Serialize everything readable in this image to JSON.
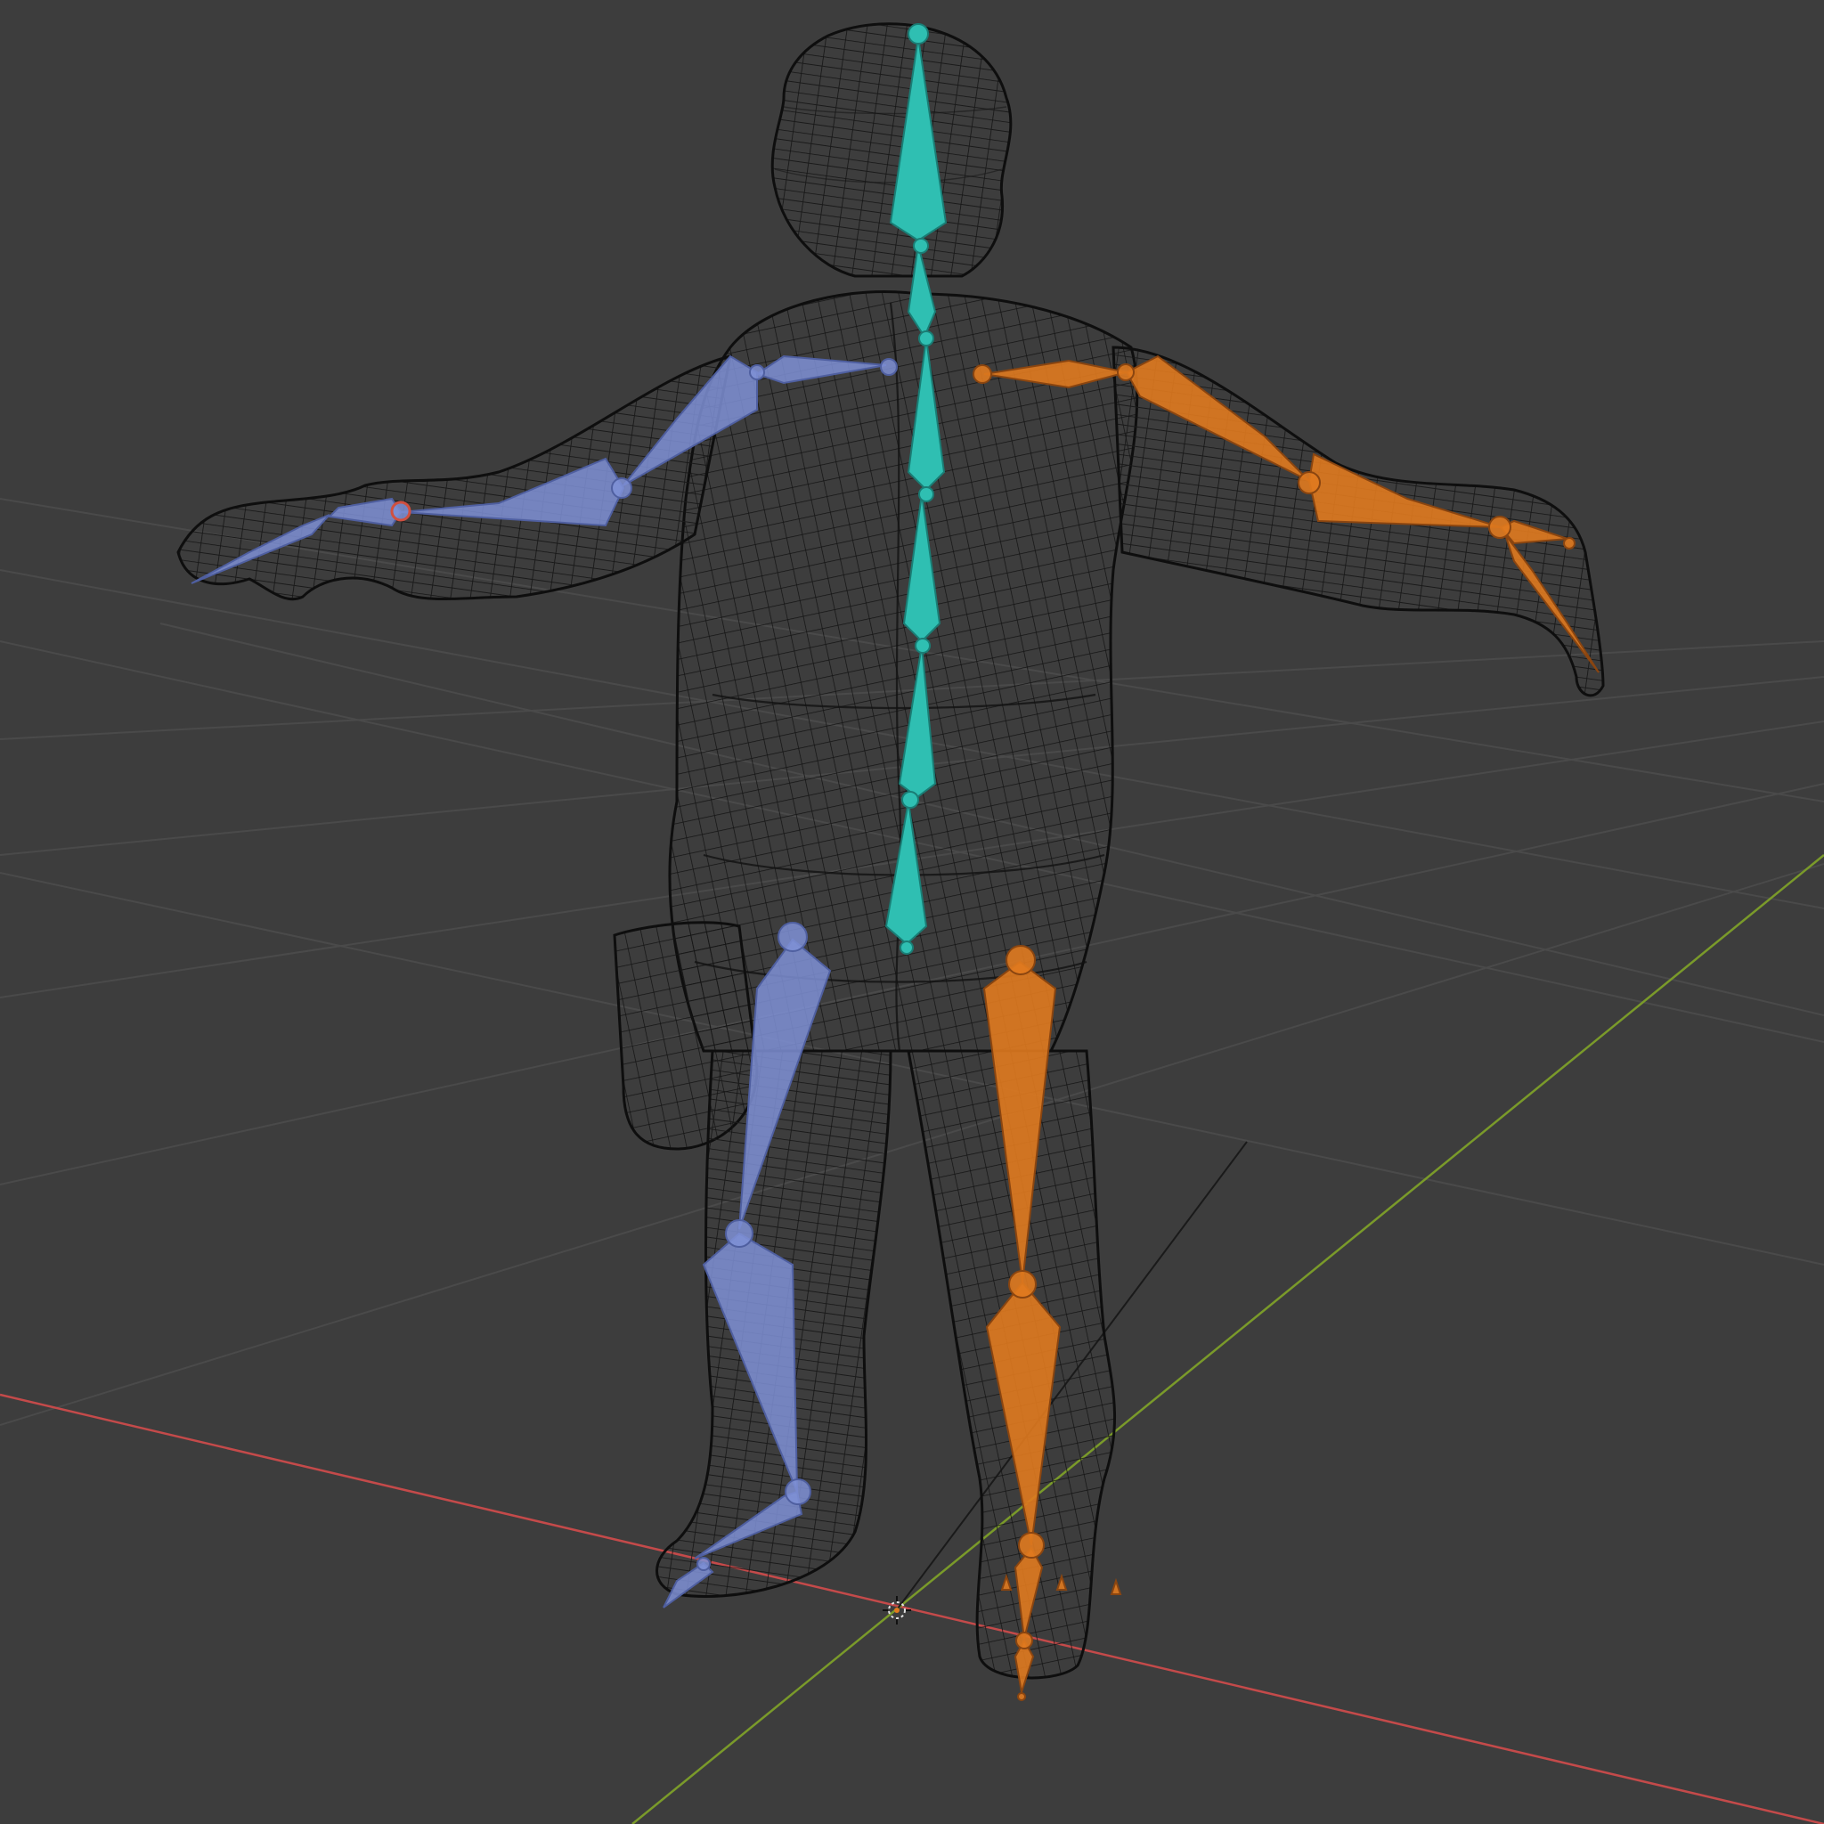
{
  "viewport": {
    "mode": "wireframe",
    "background": "#3d3d3d",
    "grid_color": "#4a4a4a"
  },
  "axes": {
    "x_axis": {
      "color": "#c44a4a"
    },
    "y_axis": {
      "color": "#7a9a2a"
    }
  },
  "mesh": {
    "type": "character",
    "display": "wireframe",
    "wire_color": "#111111"
  },
  "armature": {
    "pose": "T-pose",
    "groups": [
      {
        "id": "spine",
        "color": "#2fbfb2",
        "bones": [
          "head",
          "neck",
          "chest",
          "upper-spine",
          "spine",
          "hips"
        ]
      },
      {
        "id": "left-side",
        "color": "#7f90d6",
        "bones": [
          "shoulder",
          "upper-arm",
          "forearm",
          "hand",
          "thigh",
          "shin",
          "foot",
          "toe"
        ]
      },
      {
        "id": "right-side",
        "color": "#e07a1f",
        "bones": [
          "shoulder",
          "upper-arm",
          "forearm",
          "hand",
          "thigh",
          "shin",
          "foot",
          "toe"
        ]
      }
    ]
  },
  "icons": {
    "origin": "origin-icon",
    "cursor": "3d-cursor-icon"
  }
}
